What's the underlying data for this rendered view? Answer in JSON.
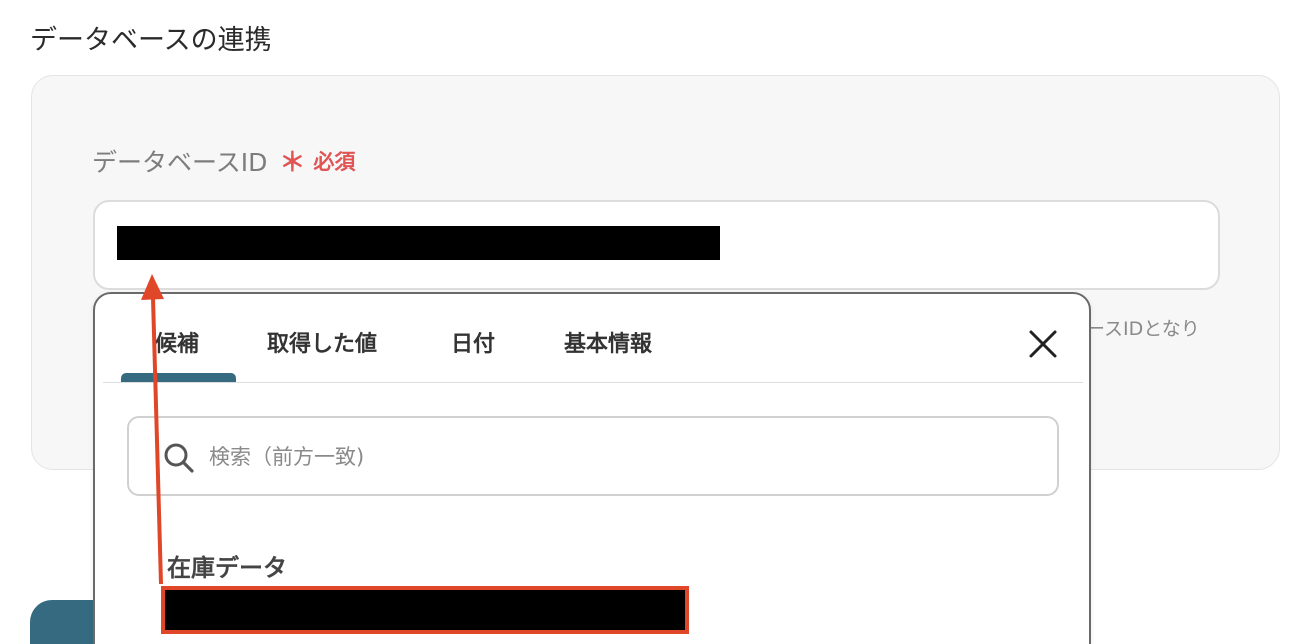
{
  "section": {
    "title": "データベースの連携"
  },
  "field": {
    "label": "データベースID",
    "required_mark": "＊",
    "required_text": "必須",
    "help_text": "ースIDとなり"
  },
  "dropdown": {
    "tabs": [
      {
        "label": "候補",
        "active": true
      },
      {
        "label": "取得した値",
        "active": false
      },
      {
        "label": "日付",
        "active": false
      },
      {
        "label": "基本情報",
        "active": false
      }
    ],
    "search_placeholder": "検索（前方一致)",
    "group_heading": "在庫データ"
  },
  "colors": {
    "accent": "#356a80",
    "required": "#e05454",
    "annotation": "#e04628"
  },
  "icons": {
    "close": "close-icon",
    "search": "search-icon"
  }
}
